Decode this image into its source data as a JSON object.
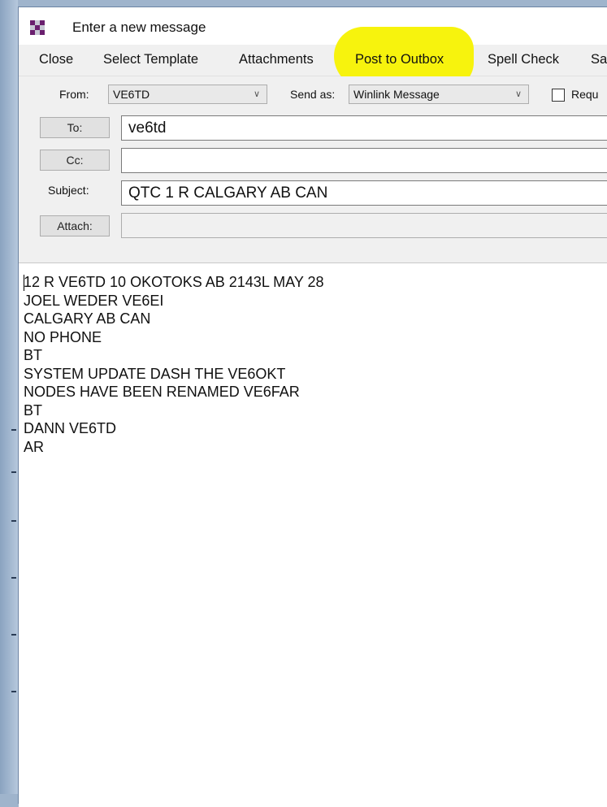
{
  "window": {
    "title": "Enter a new message"
  },
  "menu": {
    "items": [
      "Close",
      "Select Template",
      "Attachments",
      "Post to Outbox",
      "Spell Check",
      "Sa"
    ]
  },
  "form": {
    "from_label": "From:",
    "from_value": "VE6TD",
    "send_as_label": "Send as:",
    "send_as_value": "Winlink Message",
    "request_label": "Requ",
    "to_button": "To:",
    "to_value": "ve6td",
    "cc_button": "Cc:",
    "cc_value": "",
    "subject_label": "Subject:",
    "subject_value": "QTC 1 R CALGARY AB CAN",
    "attach_button": "Attach:",
    "attach_value": ""
  },
  "message": {
    "lines": [
      "12 R VE6TD 10 OKOTOKS AB 2143L MAY 28",
      "JOEL WEDER VE6EI",
      "CALGARY AB CAN",
      "NO PHONE",
      "BT",
      "SYSTEM UPDATE DASH THE VE6OKT",
      "NODES HAVE BEEN RENAMED VE6FAR",
      "BT",
      "DANN VE6TD",
      "AR"
    ]
  },
  "colors": {
    "highlight": "#f7f200",
    "window_bg": "#f0f0f0"
  }
}
